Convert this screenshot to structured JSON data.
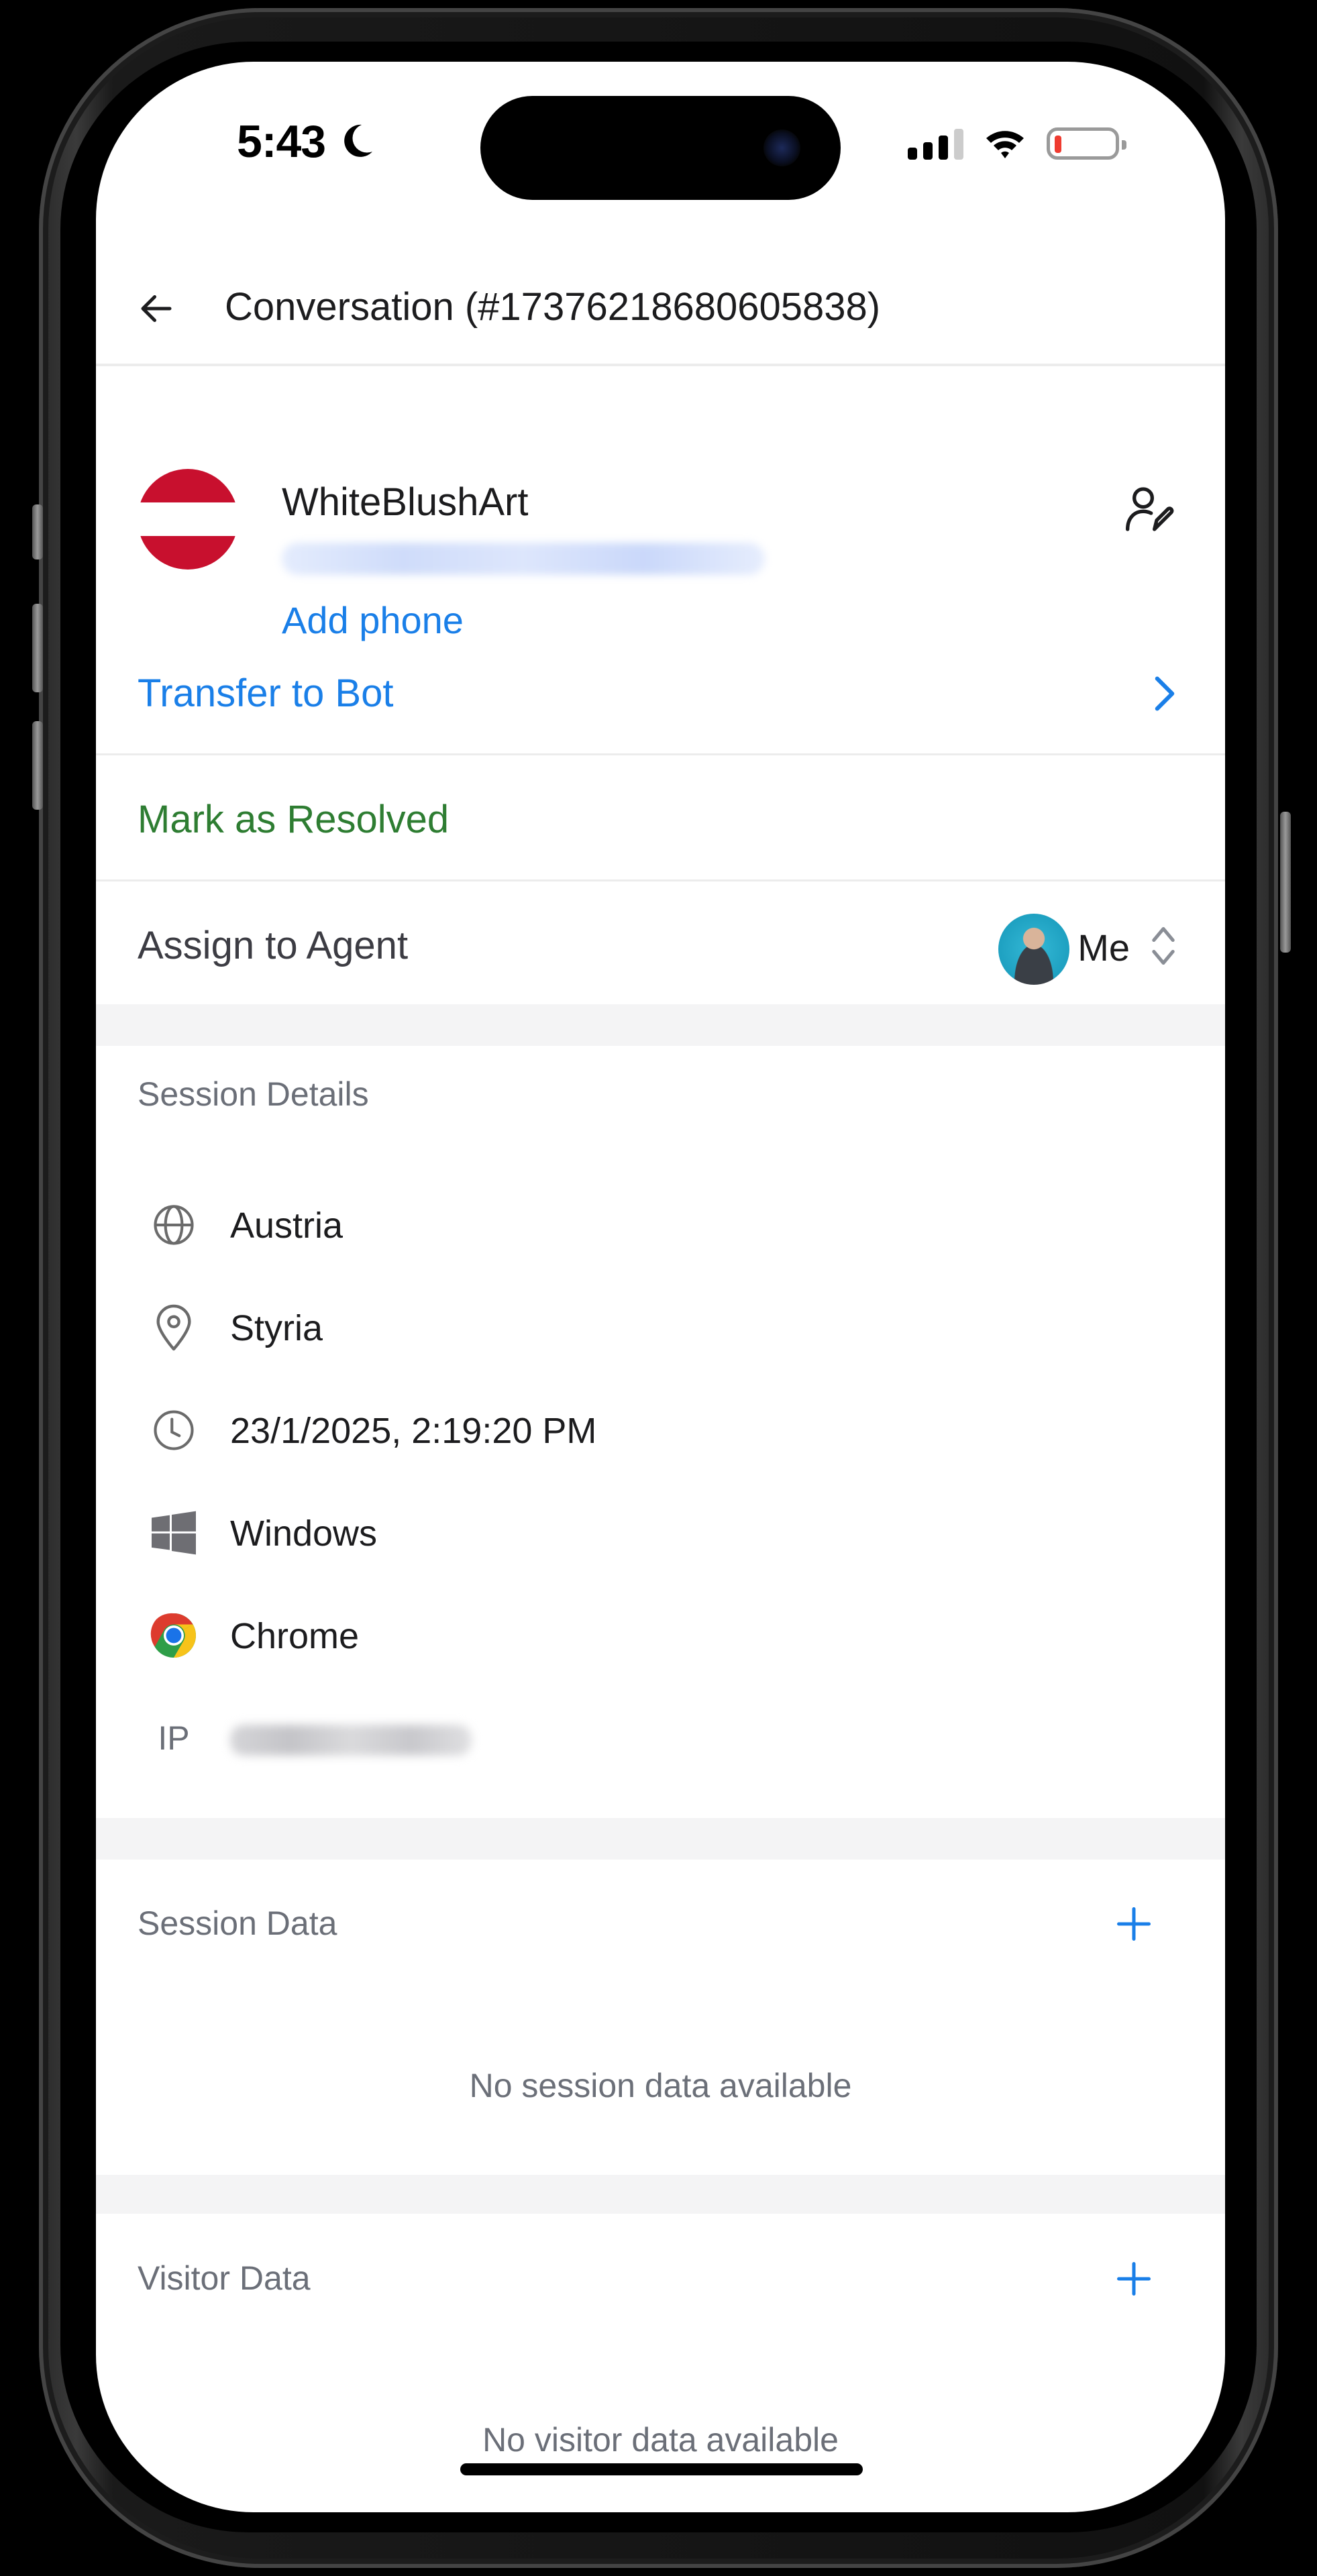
{
  "status_bar": {
    "time": "5:43",
    "focus_icon": "moon-icon",
    "signal_bars": 3,
    "signal_max": 4,
    "wifi": "full",
    "battery_percent": 10,
    "battery_color": "#ef3b30"
  },
  "header": {
    "back_icon": "arrow-left-icon",
    "title": "Conversation (#17376218680605838)"
  },
  "contact": {
    "flag": "austria-flag",
    "flag_colors": [
      "#c8102e",
      "#ffffff",
      "#c8102e"
    ],
    "name": "WhiteBlushArt",
    "email_redacted": true,
    "add_phone_label": "Add phone",
    "edit_icon": "user-edit-icon"
  },
  "actions": {
    "transfer_label": "Transfer to Bot",
    "resolve_label": "Mark as Resolved",
    "assign_label": "Assign to Agent",
    "assigned_agent": "Me"
  },
  "colors": {
    "accent_blue": "#1a7fe8",
    "resolve_green": "#2e7d32",
    "section_gray": "#6b6f78",
    "separator": "#f4f4f5"
  },
  "session_details": {
    "title": "Session Details",
    "items": [
      {
        "icon": "globe-icon",
        "value": "Austria"
      },
      {
        "icon": "map-pin-icon",
        "value": "Styria"
      },
      {
        "icon": "clock-icon",
        "value": "23/1/2025, 2:19:20 PM"
      },
      {
        "icon": "windows-icon",
        "value": "Windows"
      },
      {
        "icon": "chrome-icon",
        "value": "Chrome"
      }
    ],
    "ip_label": "IP",
    "ip_redacted": true
  },
  "session_data": {
    "title": "Session Data",
    "empty_text": "No session data available"
  },
  "visitor_data": {
    "title": "Visitor Data",
    "empty_text": "No visitor data available"
  }
}
